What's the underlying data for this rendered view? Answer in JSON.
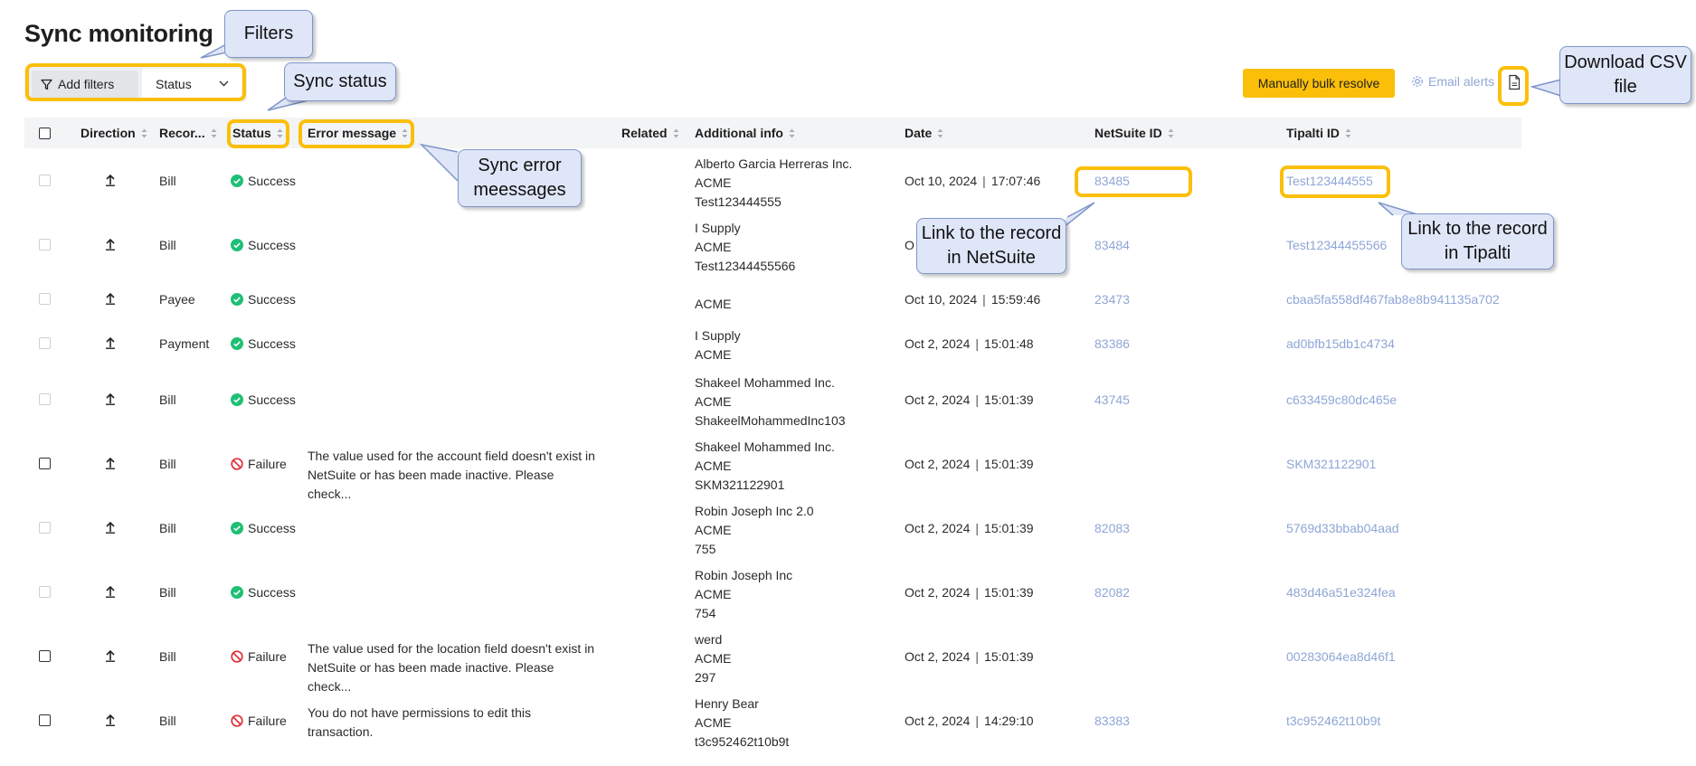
{
  "page": {
    "title": "Sync monitoring"
  },
  "toolbar": {
    "add_filters_label": "Add filters",
    "status_filter_label": "Status",
    "bulk_resolve_label": "Manually bulk resolve",
    "email_alerts_label": "Email alerts"
  },
  "table": {
    "columns": {
      "direction": "Direction",
      "record": "Recor...",
      "status": "Status",
      "error_message": "Error message",
      "related": "Related",
      "additional_info": "Additional info",
      "date": "Date",
      "netsuite_id": "NetSuite ID",
      "tipalti_id": "Tipalti ID"
    },
    "rows": [
      {
        "record": "Bill",
        "status": "Success",
        "error_line1": "",
        "error_line2": "",
        "info1": "Alberto Garcia Herreras Inc.",
        "info2": "ACME",
        "info3": "Test123444555",
        "date": "Oct 10, 2024",
        "time": "17:07:46",
        "netsuite_id": "83485",
        "tipalti_id": "Test123444555"
      },
      {
        "record": "Bill",
        "status": "Success",
        "error_line1": "",
        "error_line2": "",
        "info1": "I Supply",
        "info2": "ACME",
        "info3": "Test12344455566",
        "date": "O",
        "time": "",
        "netsuite_id": "83484",
        "tipalti_id": "Test12344455566"
      },
      {
        "record": "Payee",
        "status": "Success",
        "error_line1": "",
        "error_line2": "",
        "info1": "ACME",
        "info2": "",
        "info3": "",
        "date": "Oct 10, 2024",
        "time": "15:59:46",
        "netsuite_id": "23473",
        "tipalti_id": "cbaa5fa558df467fab8e8b941135a702"
      },
      {
        "record": "Payment",
        "status": "Success",
        "error_line1": "",
        "error_line2": "",
        "info1": "I Supply",
        "info2": "ACME",
        "info3": "",
        "date": "Oct 2, 2024",
        "time": "15:01:48",
        "netsuite_id": "83386",
        "tipalti_id": "ad0bfb15db1c4734"
      },
      {
        "record": "Bill",
        "status": "Success",
        "error_line1": "",
        "error_line2": "",
        "info1": "Shakeel Mohammed Inc.",
        "info2": "ACME",
        "info3": "ShakeelMohammedInc103",
        "date": "Oct 2, 2024",
        "time": "15:01:39",
        "netsuite_id": "43745",
        "tipalti_id": "c633459c80dc465e"
      },
      {
        "record": "Bill",
        "status": "Failure",
        "error_line1": "The value used for the account field doesn't exist in",
        "error_line2": "NetSuite or has been made inactive. Please check...",
        "info1": "Shakeel Mohammed Inc.",
        "info2": "ACME",
        "info3": "SKM321122901",
        "date": "Oct 2, 2024",
        "time": "15:01:39",
        "netsuite_id": "",
        "tipalti_id": "SKM321122901"
      },
      {
        "record": "Bill",
        "status": "Success",
        "error_line1": "",
        "error_line2": "",
        "info1": "Robin Joseph Inc 2.0",
        "info2": "ACME",
        "info3": "755",
        "date": "Oct 2, 2024",
        "time": "15:01:39",
        "netsuite_id": "82083",
        "tipalti_id": "5769d33bbab04aad"
      },
      {
        "record": "Bill",
        "status": "Success",
        "error_line1": "",
        "error_line2": "",
        "info1": "Robin Joseph Inc",
        "info2": "ACME",
        "info3": "754",
        "date": "Oct 2, 2024",
        "time": "15:01:39",
        "netsuite_id": "82082",
        "tipalti_id": "483d46a51e324fea"
      },
      {
        "record": "Bill",
        "status": "Failure",
        "error_line1": "The value used for the location field doesn't exist in",
        "error_line2": "NetSuite or has been made inactive. Please check...",
        "info1": "werd",
        "info2": "ACME",
        "info3": "297",
        "date": "Oct 2, 2024",
        "time": "15:01:39",
        "netsuite_id": "",
        "tipalti_id": "00283064ea8d46f1"
      },
      {
        "record": "Bill",
        "status": "Failure",
        "error_line1": "You do not have permissions to edit this",
        "error_line2": "transaction.",
        "info1": "Henry Bear",
        "info2": "ACME",
        "info3": "t3c952462t10b9t",
        "date": "Oct 2, 2024",
        "time": "14:29:10",
        "netsuite_id": "83383",
        "tipalti_id": "t3c952462t10b9t"
      }
    ]
  },
  "annotations": {
    "filters": "Filters",
    "sync_status": "Sync status",
    "sync_error_1": "Sync error",
    "sync_error_2": "meessages",
    "netsuite_link_1": "Link to the record",
    "netsuite_link_2": "in NetSuite",
    "tipalti_link_1": "Link to the record",
    "tipalti_link_2": "in Tipalti",
    "download_1": "Download CSV",
    "download_2": "file"
  },
  "colors": {
    "accent": "#fbbf09",
    "link": "#8fa6d6",
    "success": "#1fbf75",
    "failure": "#e0303a",
    "callout_fill": "#dfe6f8",
    "callout_border": "#7f95c9"
  }
}
